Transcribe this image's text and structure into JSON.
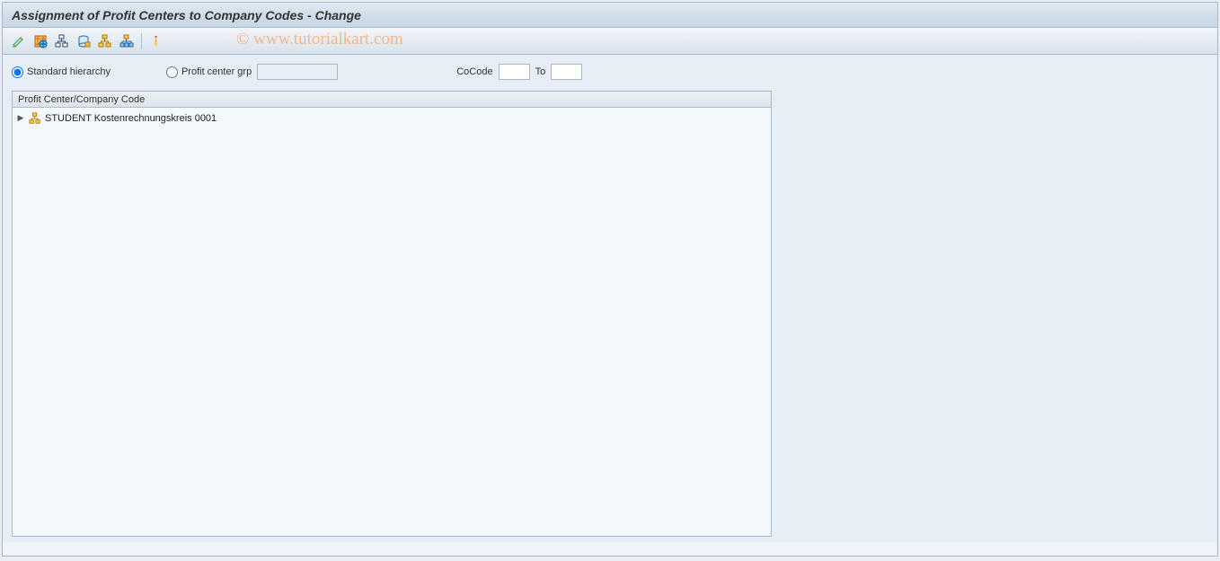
{
  "title": "Assignment of Profit Centers to Company Codes - Change",
  "watermark": "© www.tutorialkart.com",
  "toolbar": {
    "icons": [
      "pencil-display-change-icon",
      "select-all-icon",
      "hierarchy-icon",
      "storage-icon",
      "hierarchy-tree-icon",
      "org-chart-icon",
      "info-icon"
    ]
  },
  "selection": {
    "standard_hierarchy_label": "Standard hierarchy",
    "profit_center_grp_label": "Profit center grp",
    "profit_center_grp_value": "",
    "cocode_label": "CoCode",
    "cocode_from": "",
    "to_label": "To",
    "cocode_to": ""
  },
  "tree": {
    "header": "Profit Center/Company Code",
    "items": [
      {
        "label": "STUDENT Kostenrechnungskreis 0001"
      }
    ]
  }
}
